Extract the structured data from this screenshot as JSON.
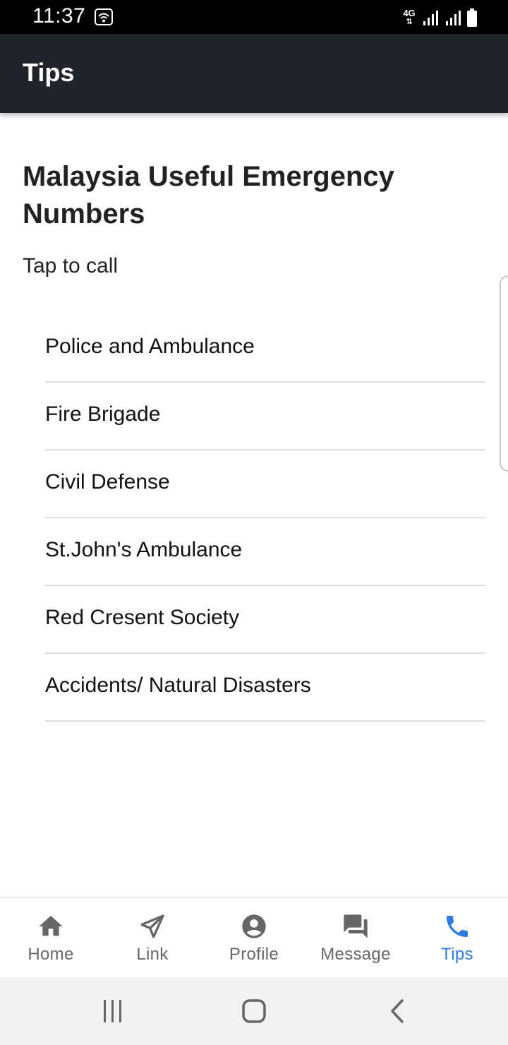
{
  "status_bar": {
    "time": "11:37",
    "network_type": "4G",
    "icons": [
      "wifi-icon",
      "signal-icon",
      "signal-icon",
      "battery-icon"
    ]
  },
  "app_bar": {
    "title": "Tips"
  },
  "main": {
    "heading": "Malaysia Useful Emergency Numbers",
    "subtitle": "Tap to call",
    "items": [
      {
        "label": "Police and Ambulance"
      },
      {
        "label": "Fire Brigade"
      },
      {
        "label": "Civil Defense"
      },
      {
        "label": "St.John's Ambulance"
      },
      {
        "label": "Red Cresent Society"
      },
      {
        "label": "Accidents/ Natural Disasters"
      }
    ]
  },
  "bottom_nav": {
    "items": [
      {
        "label": "Home",
        "icon": "home-icon"
      },
      {
        "label": "Link",
        "icon": "send-icon"
      },
      {
        "label": "Profile",
        "icon": "account-icon"
      },
      {
        "label": "Message",
        "icon": "chat-icon"
      },
      {
        "label": "Tips",
        "icon": "phone-icon"
      }
    ],
    "active": "Tips"
  },
  "colors": {
    "app_bar": "#222429",
    "accent": "#2f7be6",
    "inactive": "#666666"
  }
}
